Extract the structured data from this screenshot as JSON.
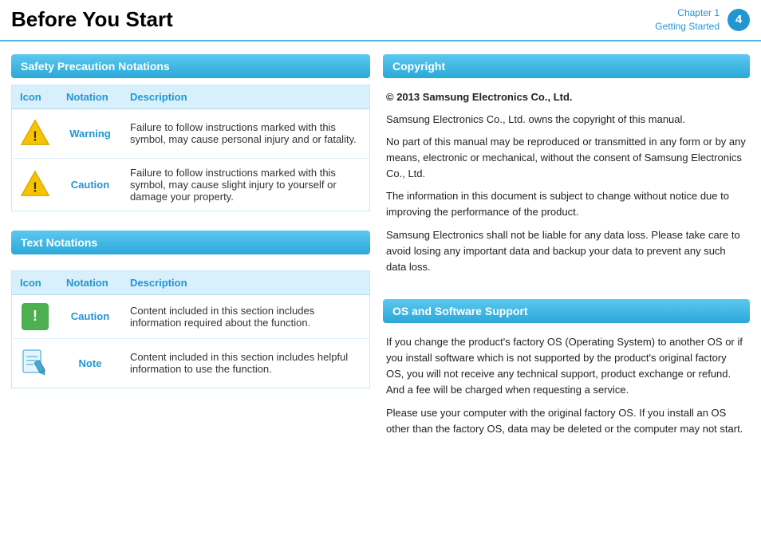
{
  "header": {
    "title": "Before You Start",
    "chapter_label": "Chapter 1",
    "chapter_sublabel": "Getting Started",
    "chapter_number": "4"
  },
  "left": {
    "safety_section_title": "Safety Precaution Notations",
    "safety_table": {
      "columns": [
        "Icon",
        "Notation",
        "Description"
      ],
      "rows": [
        {
          "icon_type": "warning-triangle",
          "notation": "Warning",
          "description": "Failure to follow instructions marked with this symbol, may cause personal injury and or fatality."
        },
        {
          "icon_type": "caution-triangle",
          "notation": "Caution",
          "description": "Failure to follow instructions marked with this symbol, may cause slight injury to yourself or damage your property."
        }
      ]
    },
    "text_section_title": "Text Notations",
    "text_table": {
      "columns": [
        "Icon",
        "Notation",
        "Description"
      ],
      "rows": [
        {
          "icon_type": "green-caution",
          "notation": "Caution",
          "description": "Content included in this section includes information required about the function."
        },
        {
          "icon_type": "note-pencil",
          "notation": "Note",
          "description": "Content included in this section includes helpful information to use the function."
        }
      ]
    }
  },
  "right": {
    "copyright_section_title": "Copyright",
    "copyright_bold": "© 2013 Samsung Electronics Co., Ltd.",
    "copyright_paragraphs": [
      "Samsung Electronics Co., Ltd. owns the copyright of this manual.",
      "No part of this manual may be reproduced or transmitted in any form or by any means, electronic or mechanical, without the consent of Samsung Electronics Co., Ltd.",
      "The information in this document is subject to change without notice due to improving the performance of the product.",
      "Samsung Electronics shall not be liable for any data loss. Please take care to avoid losing any important data and backup your data to prevent any such data loss."
    ],
    "os_section_title": "OS and Software Support",
    "os_paragraphs": [
      "If you change the product's factory OS (Operating System) to another OS or if you install software which is not supported by the product's original factory OS, you will not receive any technical support, product exchange or refund. And a fee will be charged when requesting a service.",
      "Please use your computer with the original factory OS. If you install an OS other than the factory OS, data may be deleted or the computer may not start."
    ]
  }
}
